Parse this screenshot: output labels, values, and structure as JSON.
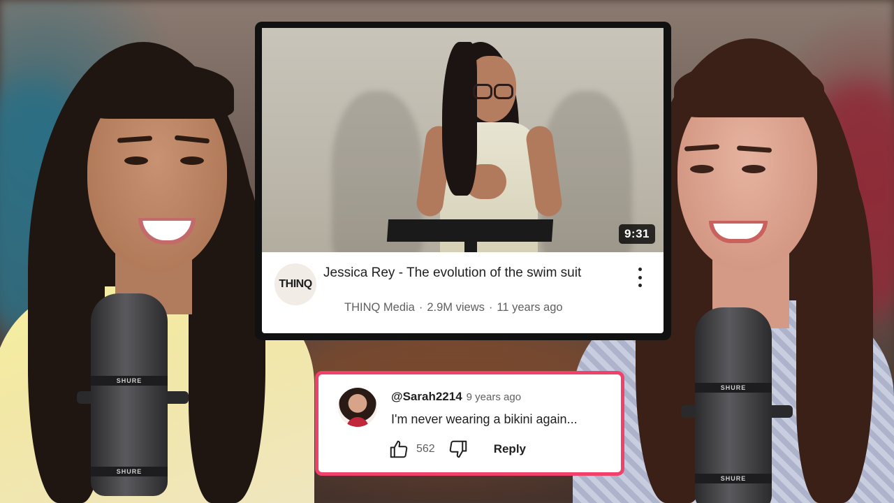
{
  "video": {
    "title": "Jessica Rey - The evolution of the swim suit",
    "duration": "9:31",
    "channel_avatar_text": "THINQ",
    "channel": "THINQ Media",
    "views": "2.9M views",
    "age": "11 years ago",
    "separator": "·",
    "menu_icon": "more-vert-icon"
  },
  "comment": {
    "username": "@Sarah2214",
    "time": "9 years ago",
    "text": "I'm never wearing a bikini again...",
    "like_count": "562",
    "reply_label": "Reply",
    "like_icon": "thumbs-up-icon",
    "dislike_icon": "thumbs-down-icon",
    "border_color": "#f0416b"
  },
  "mics": {
    "brand": "SHURE"
  }
}
